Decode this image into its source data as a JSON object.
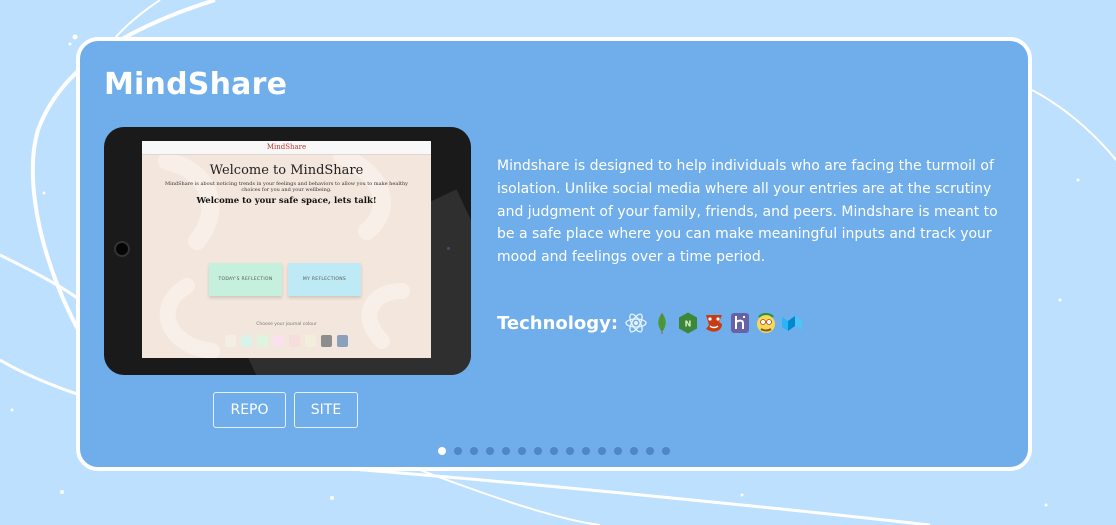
{
  "project": {
    "title": "MindShare",
    "description": "Mindshare is designed to help individuals who are facing the turmoil of isolation. Unlike social media where all your entries are at the scrutiny and judgment of your family, friends, and peers. Mindshare is meant to be a safe place where you can make meaningful inputs and track your mood and feelings over a time period.",
    "technology_label": "Technology:",
    "technologies": [
      "react-icon",
      "mongodb-icon",
      "nodejs-icon",
      "jest-icon",
      "heroku-icon",
      "babel-icon",
      "materialize-icon"
    ],
    "buttons": {
      "repo": "REPO",
      "site": "SITE"
    }
  },
  "preview": {
    "brand": "MindShare",
    "heading": "Welcome to MindShare",
    "subtext": "MindShare is about noticing trends in your feelings and behaviors to allow you to make healthy choices for you and your wellbeing.",
    "safe_space": "Welcome to your safe space, lets talk!",
    "btn_today": "TODAY'S REFLECTION",
    "btn_my": "MY REFLECTIONS",
    "colors_label": "Choose your journal colour",
    "swatches": [
      "#f3efe6",
      "#d8f3ea",
      "#dff4dc",
      "#fbe0ee",
      "#f6dede",
      "#f3eedb",
      "#8d8d8d",
      "#8aa0bb"
    ]
  },
  "carousel": {
    "total": 15,
    "active_index": 0
  },
  "colors": {
    "background": "#bde0fe",
    "card": "#6faeea",
    "card_border": "#ffffff",
    "dot_inactive": "#4f86c6",
    "dot_active": "#ffffff"
  }
}
